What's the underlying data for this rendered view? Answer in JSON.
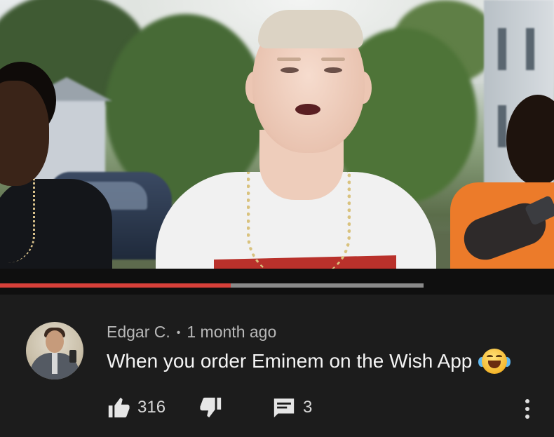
{
  "video": {
    "progress_fraction": 0.545,
    "buffered_fraction": 1.0
  },
  "comment": {
    "author": "Edgar C.",
    "separator": "•",
    "time_ago": "1 month ago",
    "text": "When you order Eminem on the Wish App",
    "emoji": "face-with-tears-of-joy-icon",
    "likes": "316",
    "replies": "3"
  },
  "colors": {
    "background": "#1c1c1c",
    "progress_played": "#d7403a",
    "progress_buffered": "#8a8a8a",
    "meta_text": "#b8b8b8"
  },
  "icons": {
    "like": "thumbs-up-icon",
    "dislike": "thumbs-down-icon",
    "reply": "comment-icon",
    "more": "more-vertical-icon"
  }
}
